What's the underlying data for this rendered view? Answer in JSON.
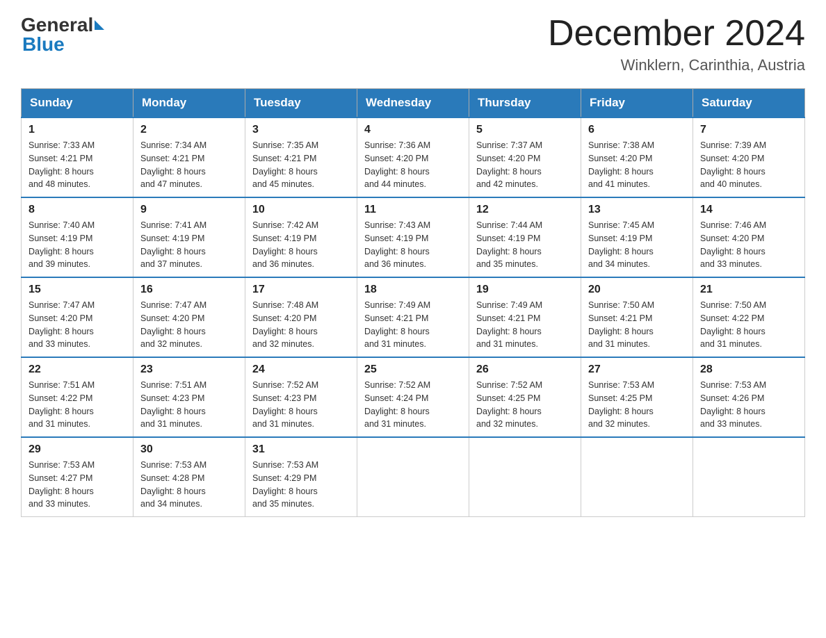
{
  "header": {
    "title": "December 2024",
    "subtitle": "Winklern, Carinthia, Austria",
    "logo_general": "General",
    "logo_blue": "Blue"
  },
  "weekdays": [
    "Sunday",
    "Monday",
    "Tuesday",
    "Wednesday",
    "Thursday",
    "Friday",
    "Saturday"
  ],
  "weeks": [
    [
      {
        "day": "1",
        "sunrise": "7:33 AM",
        "sunset": "4:21 PM",
        "daylight": "8 hours and 48 minutes."
      },
      {
        "day": "2",
        "sunrise": "7:34 AM",
        "sunset": "4:21 PM",
        "daylight": "8 hours and 47 minutes."
      },
      {
        "day": "3",
        "sunrise": "7:35 AM",
        "sunset": "4:21 PM",
        "daylight": "8 hours and 45 minutes."
      },
      {
        "day": "4",
        "sunrise": "7:36 AM",
        "sunset": "4:20 PM",
        "daylight": "8 hours and 44 minutes."
      },
      {
        "day": "5",
        "sunrise": "7:37 AM",
        "sunset": "4:20 PM",
        "daylight": "8 hours and 42 minutes."
      },
      {
        "day": "6",
        "sunrise": "7:38 AM",
        "sunset": "4:20 PM",
        "daylight": "8 hours and 41 minutes."
      },
      {
        "day": "7",
        "sunrise": "7:39 AM",
        "sunset": "4:20 PM",
        "daylight": "8 hours and 40 minutes."
      }
    ],
    [
      {
        "day": "8",
        "sunrise": "7:40 AM",
        "sunset": "4:19 PM",
        "daylight": "8 hours and 39 minutes."
      },
      {
        "day": "9",
        "sunrise": "7:41 AM",
        "sunset": "4:19 PM",
        "daylight": "8 hours and 37 minutes."
      },
      {
        "day": "10",
        "sunrise": "7:42 AM",
        "sunset": "4:19 PM",
        "daylight": "8 hours and 36 minutes."
      },
      {
        "day": "11",
        "sunrise": "7:43 AM",
        "sunset": "4:19 PM",
        "daylight": "8 hours and 36 minutes."
      },
      {
        "day": "12",
        "sunrise": "7:44 AM",
        "sunset": "4:19 PM",
        "daylight": "8 hours and 35 minutes."
      },
      {
        "day": "13",
        "sunrise": "7:45 AM",
        "sunset": "4:19 PM",
        "daylight": "8 hours and 34 minutes."
      },
      {
        "day": "14",
        "sunrise": "7:46 AM",
        "sunset": "4:20 PM",
        "daylight": "8 hours and 33 minutes."
      }
    ],
    [
      {
        "day": "15",
        "sunrise": "7:47 AM",
        "sunset": "4:20 PM",
        "daylight": "8 hours and 33 minutes."
      },
      {
        "day": "16",
        "sunrise": "7:47 AM",
        "sunset": "4:20 PM",
        "daylight": "8 hours and 32 minutes."
      },
      {
        "day": "17",
        "sunrise": "7:48 AM",
        "sunset": "4:20 PM",
        "daylight": "8 hours and 32 minutes."
      },
      {
        "day": "18",
        "sunrise": "7:49 AM",
        "sunset": "4:21 PM",
        "daylight": "8 hours and 31 minutes."
      },
      {
        "day": "19",
        "sunrise": "7:49 AM",
        "sunset": "4:21 PM",
        "daylight": "8 hours and 31 minutes."
      },
      {
        "day": "20",
        "sunrise": "7:50 AM",
        "sunset": "4:21 PM",
        "daylight": "8 hours and 31 minutes."
      },
      {
        "day": "21",
        "sunrise": "7:50 AM",
        "sunset": "4:22 PM",
        "daylight": "8 hours and 31 minutes."
      }
    ],
    [
      {
        "day": "22",
        "sunrise": "7:51 AM",
        "sunset": "4:22 PM",
        "daylight": "8 hours and 31 minutes."
      },
      {
        "day": "23",
        "sunrise": "7:51 AM",
        "sunset": "4:23 PM",
        "daylight": "8 hours and 31 minutes."
      },
      {
        "day": "24",
        "sunrise": "7:52 AM",
        "sunset": "4:23 PM",
        "daylight": "8 hours and 31 minutes."
      },
      {
        "day": "25",
        "sunrise": "7:52 AM",
        "sunset": "4:24 PM",
        "daylight": "8 hours and 31 minutes."
      },
      {
        "day": "26",
        "sunrise": "7:52 AM",
        "sunset": "4:25 PM",
        "daylight": "8 hours and 32 minutes."
      },
      {
        "day": "27",
        "sunrise": "7:53 AM",
        "sunset": "4:25 PM",
        "daylight": "8 hours and 32 minutes."
      },
      {
        "day": "28",
        "sunrise": "7:53 AM",
        "sunset": "4:26 PM",
        "daylight": "8 hours and 33 minutes."
      }
    ],
    [
      {
        "day": "29",
        "sunrise": "7:53 AM",
        "sunset": "4:27 PM",
        "daylight": "8 hours and 33 minutes."
      },
      {
        "day": "30",
        "sunrise": "7:53 AM",
        "sunset": "4:28 PM",
        "daylight": "8 hours and 34 minutes."
      },
      {
        "day": "31",
        "sunrise": "7:53 AM",
        "sunset": "4:29 PM",
        "daylight": "8 hours and 35 minutes."
      },
      null,
      null,
      null,
      null
    ]
  ],
  "labels": {
    "sunrise": "Sunrise:",
    "sunset": "Sunset:",
    "daylight": "Daylight:"
  }
}
